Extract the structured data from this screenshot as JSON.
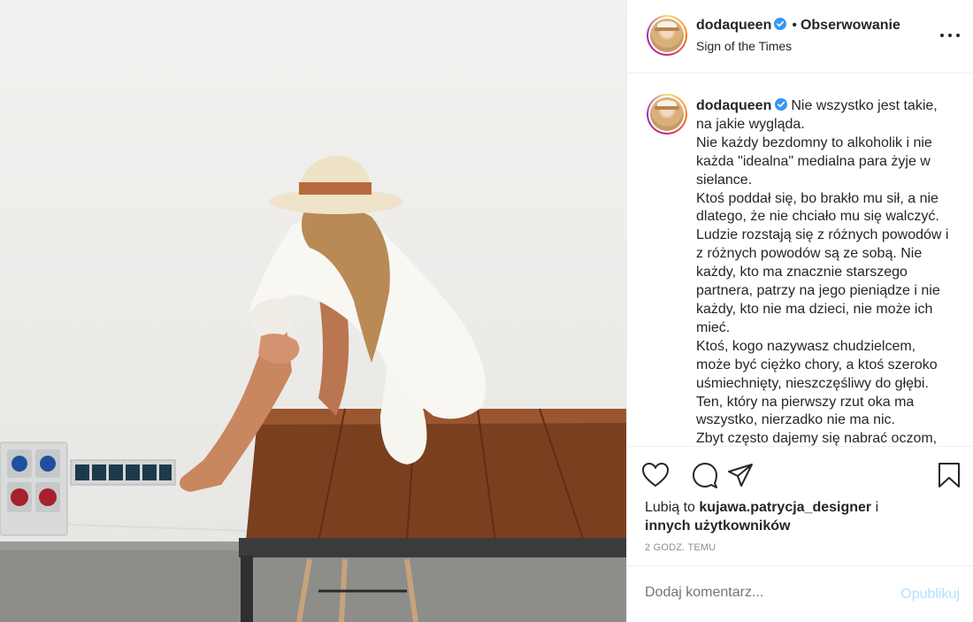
{
  "header": {
    "username": "dodaqueen",
    "follow_dot": "•",
    "follow_label": "Obserwowanie",
    "subtitle": "Sign of the Times",
    "verified_icon": "verified-badge-icon",
    "more_icon": "more-options-icon"
  },
  "caption": {
    "username": "dodaqueen",
    "text": "Nie wszystko jest takie, na jakie wygląda.\nNie każdy bezdomny to alkoholik i nie każda \"idealna\" medialna para żyje w sielance.\nKtoś poddał się, bo brakło mu sił, a nie dlatego, że nie chciało mu się walczyć.\nLudzie rozstają się z różnych powodów i z różnych powodów są ze sobą. Nie każdy, kto ma znacznie starszego partnera, patrzy na jego pieniądze i nie każdy, kto nie ma dzieci, nie może ich mieć.\nKtoś, kogo nazywasz chudzielcem, może być ciężko chory, a ktoś szeroko uśmiechnięty, nieszczęśliwy do głębi.\nTen, który na pierwszy rzut oka ma wszystko, nierzadko nie ma nic.\nZbyt często dajemy się nabrać oczom,"
  },
  "actions": {
    "like_icon": "heart-icon",
    "comment_icon": "comment-bubble-icon",
    "share_icon": "paper-plane-icon",
    "save_icon": "bookmark-icon"
  },
  "likes": {
    "prefix": "Lubią to",
    "user": "kujawa.patrycja_designer",
    "conj": "i",
    "others": "innych użytkowników"
  },
  "timestamp": "2 GODZ. TEMU",
  "comment": {
    "placeholder": "Dodaj komentarz...",
    "publish_label": "Opublikuj"
  },
  "colors": {
    "verified": "#3897f0",
    "text": "#262626",
    "muted": "#8e8e8e",
    "publish_disabled": "#b2dffc",
    "border": "#efefef"
  }
}
